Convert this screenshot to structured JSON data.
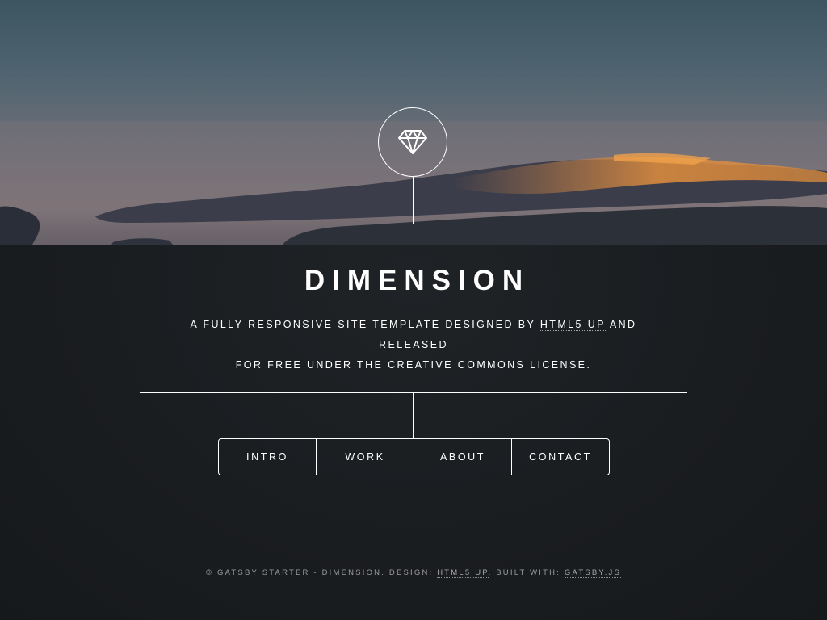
{
  "header": {
    "logo_icon": "diamond-icon",
    "title": "DIMENSION",
    "tagline": {
      "part1": "A FULLY RESPONSIVE SITE TEMPLATE DESIGNED BY ",
      "link1": "HTML5 UP",
      "part2": " AND RELEASED",
      "part3": "FOR FREE UNDER THE ",
      "link2": "CREATIVE COMMONS",
      "part4": " LICENSE."
    }
  },
  "nav": {
    "items": [
      {
        "label": "INTRO"
      },
      {
        "label": "WORK"
      },
      {
        "label": "ABOUT"
      },
      {
        "label": "CONTACT"
      }
    ]
  },
  "footer": {
    "prefix": "© GATSBY STARTER - DIMENSION. DESIGN: ",
    "link1": "HTML5 UP",
    "middle": ". BUILT WITH: ",
    "link2": "GATSBY.JS"
  },
  "colors": {
    "background": "#1b1f22",
    "foreground": "#ffffff",
    "cloud_highlight": "#e8913a"
  }
}
